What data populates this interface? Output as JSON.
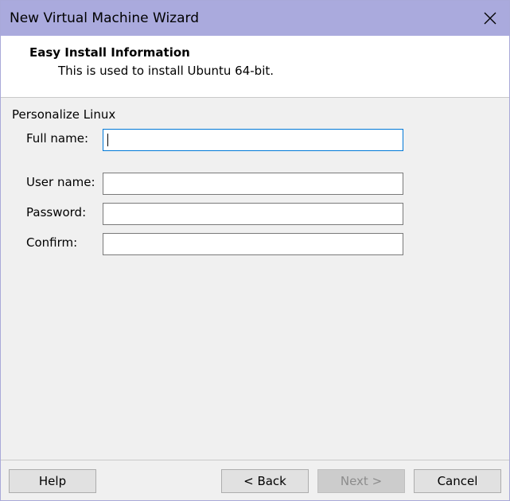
{
  "window": {
    "title": "New Virtual Machine Wizard"
  },
  "header": {
    "title": "Easy Install Information",
    "subtitle": "This is used to install Ubuntu 64-bit."
  },
  "form": {
    "section_label": "Personalize Linux",
    "full_name_label": "Full name:",
    "full_name_value": "",
    "user_name_label": "User name:",
    "user_name_value": "",
    "password_label": "Password:",
    "password_value": "",
    "confirm_label": "Confirm:",
    "confirm_value": ""
  },
  "footer": {
    "help_label": "Help",
    "back_label": "< Back",
    "next_label": "Next >",
    "cancel_label": "Cancel"
  },
  "icons": {
    "close": "close-icon"
  },
  "colors": {
    "titlebar": "#aaaadd",
    "focus_border": "#0078d7"
  }
}
